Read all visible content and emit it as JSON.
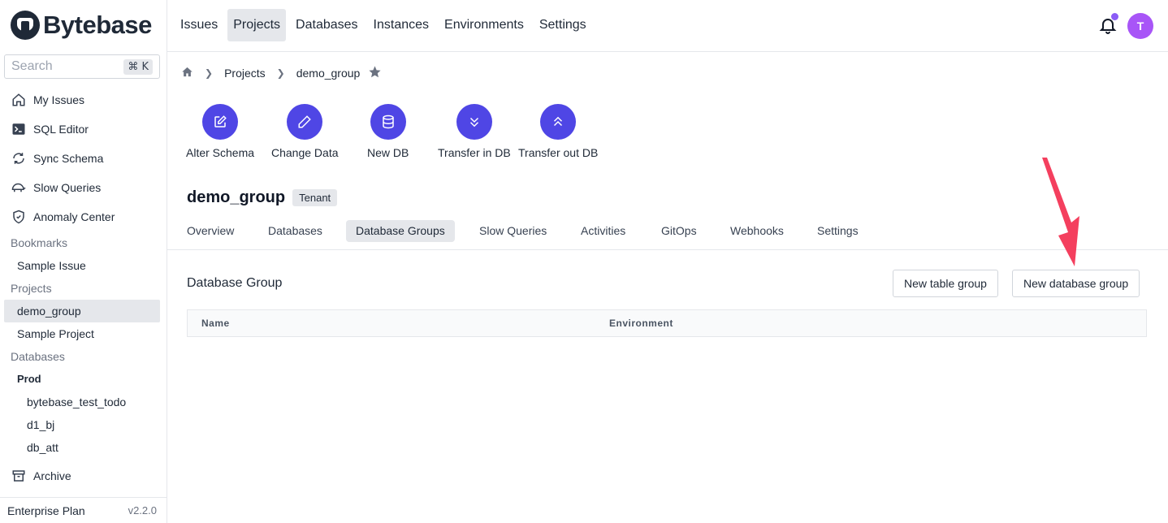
{
  "app": {
    "name": "Bytebase",
    "version": "v2.2.0",
    "plan": "Enterprise Plan"
  },
  "search": {
    "placeholder": "Search",
    "shortcut": "⌘ K"
  },
  "sidebar": {
    "items": [
      {
        "label": "My Issues",
        "icon": "home-icon"
      },
      {
        "label": "SQL Editor",
        "icon": "terminal-icon"
      },
      {
        "label": "Sync Schema",
        "icon": "sync-icon"
      },
      {
        "label": "Slow Queries",
        "icon": "turtle-icon"
      },
      {
        "label": "Anomaly Center",
        "icon": "shield-icon"
      }
    ],
    "bookmarks_label": "Bookmarks",
    "bookmarks": [
      "Sample Issue"
    ],
    "projects_label": "Projects",
    "projects": [
      "demo_group",
      "Sample Project"
    ],
    "databases_label": "Databases",
    "environment": "Prod",
    "databases": [
      "bytebase_test_todo",
      "d1_bj",
      "db_att"
    ],
    "archive_label": "Archive"
  },
  "topnav": {
    "items": [
      "Issues",
      "Projects",
      "Databases",
      "Instances",
      "Environments",
      "Settings"
    ],
    "active": "Projects",
    "avatar_initial": "T"
  },
  "breadcrumb": {
    "items": [
      "Projects",
      "demo_group"
    ]
  },
  "quick_actions": [
    {
      "label": "Alter Schema",
      "icon": "edit-square-icon"
    },
    {
      "label": "Change Data",
      "icon": "pencil-icon"
    },
    {
      "label": "New DB",
      "icon": "database-icon"
    },
    {
      "label": "Transfer in DB",
      "icon": "double-chevron-down-icon"
    },
    {
      "label": "Transfer out DB",
      "icon": "double-chevron-up-icon"
    }
  ],
  "project": {
    "name": "demo_group",
    "mode": "Tenant"
  },
  "tabs": {
    "items": [
      "Overview",
      "Databases",
      "Database Groups",
      "Slow Queries",
      "Activities",
      "GitOps",
      "Webhooks",
      "Settings"
    ],
    "active": "Database Groups"
  },
  "database_group": {
    "title": "Database Group",
    "new_table_group": "New table group",
    "new_database_group": "New database group",
    "columns": [
      "Name",
      "Environment"
    ]
  },
  "colors": {
    "accent": "#4f46e5",
    "annotation_arrow": "#f43f5e",
    "avatar": "#a855f7"
  }
}
